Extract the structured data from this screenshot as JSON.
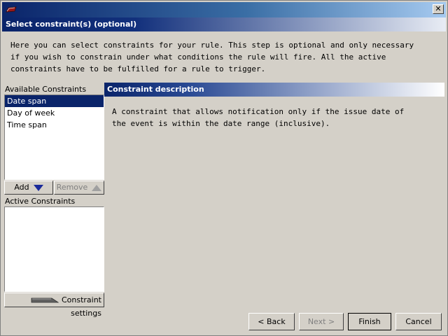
{
  "window": {
    "close_glyph": "✕"
  },
  "step_header": {
    "title": "Select constraint(s) (optional)"
  },
  "intro": {
    "line1": "Here you can select constraints for your rule. This step is optional and only necessary",
    "line2": "if you wish to constrain under what conditions the rule will fire. All the active",
    "line3": "constraints have to be fulfilled for a rule to trigger."
  },
  "available": {
    "label": "Available Constraints",
    "items": [
      "Date span",
      "Day of week",
      "Time span"
    ],
    "selected_index": 0
  },
  "buttons": {
    "add": "Add",
    "remove": "Remove",
    "constraint_settings": "Constraint settings"
  },
  "active": {
    "label": "Active Constraints",
    "items": []
  },
  "description": {
    "header": "Constraint description",
    "line1": "A constraint that allows notification only if the issue date of",
    "line2": "the event is within the date range (inclusive)."
  },
  "nav": {
    "back": "< Back",
    "next": "Next >",
    "finish": "Finish",
    "cancel": "Cancel"
  },
  "colors": {
    "selection": "#0a246a",
    "header_dark": "#0a246a",
    "dialog_bg": "#d4d0c8"
  }
}
